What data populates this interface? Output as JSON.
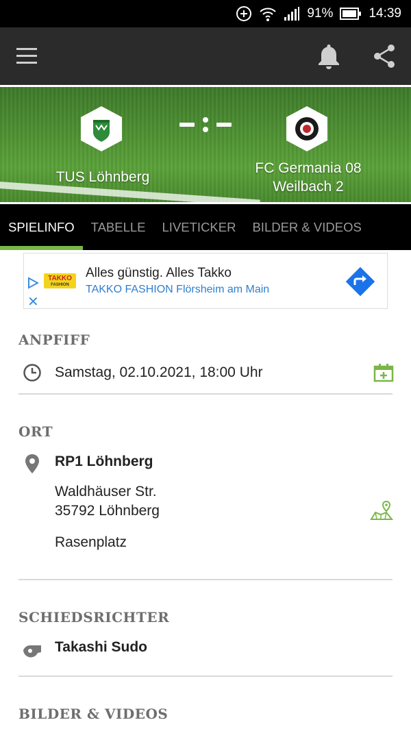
{
  "statusbar": {
    "battery_pct": "91%",
    "time": "14:39"
  },
  "match": {
    "home_team": "TUS Löhnberg",
    "away_team_line1": "FC Germania 08",
    "away_team_line2": "Weilbach 2",
    "score_display": "-:-"
  },
  "tabs": [
    {
      "label": "SPIELINFO",
      "active": true
    },
    {
      "label": "TABELLE",
      "active": false
    },
    {
      "label": "LIVETICKER",
      "active": false
    },
    {
      "label": "BILDER & VIDEOS",
      "active": false
    }
  ],
  "ad": {
    "logo_text": "TAKKO",
    "logo_subtext": "FASHION",
    "headline": "Alles günstig. Alles Takko",
    "subline": "TAKKO FASHION Flörsheim am Main"
  },
  "anpfiff": {
    "title": "ANPFIFF",
    "datetime": "Samstag, 02.10.2021, 18:00 Uhr"
  },
  "ort": {
    "title": "ORT",
    "venue": "RP1 Löhnberg",
    "street": "Waldhäuser Str.",
    "city": "35792 Löhnberg",
    "surface": "Rasenplatz"
  },
  "schiedsrichter": {
    "title": "SCHIEDSRICHTER",
    "name": "Takashi Sudo"
  },
  "bilder": {
    "title": "BILDER & VIDEOS"
  },
  "colors": {
    "accent": "#7ab648",
    "appbar": "#2b2b2b",
    "ad_link": "#2f7fd0"
  }
}
